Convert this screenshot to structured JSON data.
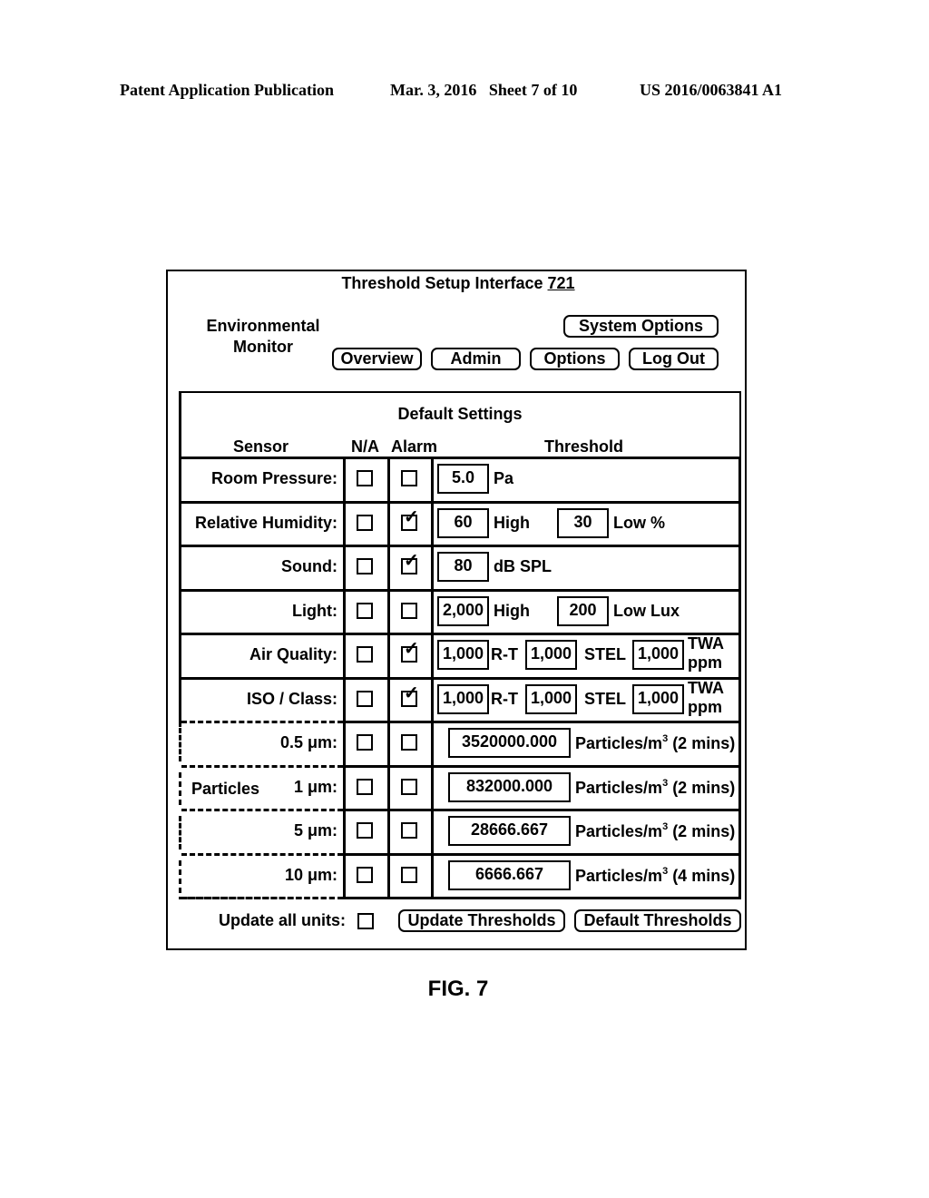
{
  "publication_header": {
    "left": "Patent Application Publication",
    "middle": "Mar. 3, 2016   Sheet 7 of 10",
    "right": "US 2016/0063841 A1"
  },
  "window": {
    "title": "Threshold Setup Interface",
    "ref_number": "721",
    "brand_line1": "Environmental",
    "brand_line2": "Monitor"
  },
  "nav": {
    "system_options": "System Options",
    "overview": "Overview",
    "admin": "Admin",
    "options": "Options",
    "log_out": "Log Out"
  },
  "settings": {
    "title": "Default Settings",
    "columns": {
      "sensor": "Sensor",
      "na": "N/A",
      "alarm": "Alarm",
      "threshold": "Threshold"
    },
    "group_label": "Particles",
    "rows": [
      {
        "label": "Room Pressure:",
        "na": false,
        "alarm": false,
        "fields": [
          "5.0"
        ],
        "units": [
          "Pa"
        ]
      },
      {
        "label": "Relative Humidity:",
        "na": false,
        "alarm": true,
        "fields": [
          "60",
          "30"
        ],
        "units": [
          "High",
          "Low %"
        ]
      },
      {
        "label": "Sound:",
        "na": false,
        "alarm": true,
        "fields": [
          "80"
        ],
        "units": [
          "dB SPL"
        ]
      },
      {
        "label": "Light:",
        "na": false,
        "alarm": false,
        "fields": [
          "2,000",
          "200"
        ],
        "units": [
          "High",
          "Low Lux"
        ]
      },
      {
        "label": "Air Quality:",
        "na": false,
        "alarm": true,
        "fields": [
          "1,000",
          "1,000",
          "1,000"
        ],
        "units": [
          "R-T",
          "STEL",
          "TWA",
          "ppm"
        ]
      },
      {
        "label": "ISO / Class:",
        "na": false,
        "alarm": true,
        "fields": [
          "1,000",
          "1,000",
          "1,000"
        ],
        "units": [
          "R-T",
          "STEL",
          "TWA",
          "ppm"
        ]
      },
      {
        "label": "0.5 μm:",
        "na": false,
        "alarm": false,
        "fields": [
          "3520000.000"
        ],
        "units": [
          "Particles/m",
          "3",
          " (2 mins)"
        ]
      },
      {
        "label": "1 μm:",
        "na": false,
        "alarm": false,
        "fields": [
          "832000.000"
        ],
        "units": [
          "Particles/m",
          "3",
          " (2 mins)"
        ]
      },
      {
        "label": "5 μm:",
        "na": false,
        "alarm": false,
        "fields": [
          "28666.667"
        ],
        "units": [
          "Particles/m",
          "3",
          " (2 mins)"
        ]
      },
      {
        "label": "10 μm:",
        "na": false,
        "alarm": false,
        "fields": [
          "6666.667"
        ],
        "units": [
          "Particles/m",
          "3",
          " (4 mins)"
        ]
      }
    ]
  },
  "footer": {
    "update_all_label": "Update all units:",
    "update_all_checked": false,
    "update_button": "Update Thresholds",
    "default_button": "Default Thresholds"
  },
  "figure_label": "FIG. 7"
}
